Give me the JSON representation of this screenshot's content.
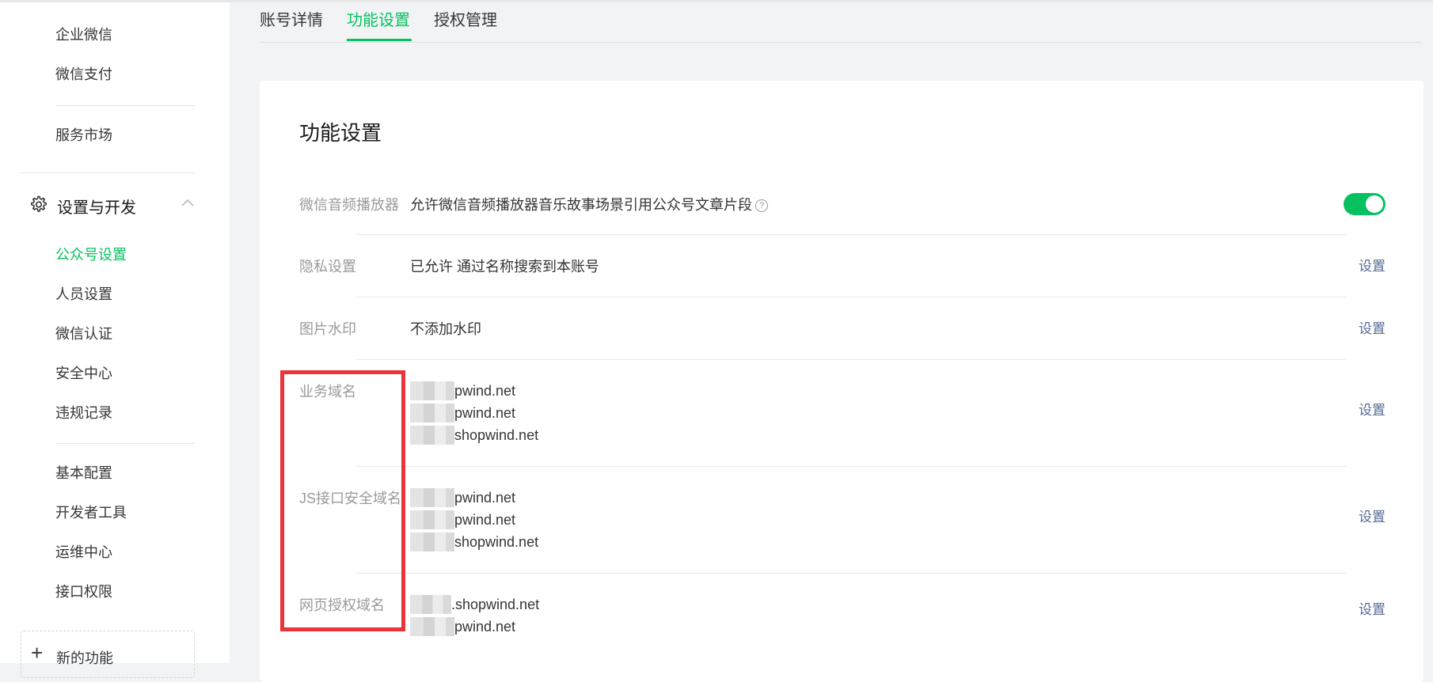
{
  "sidebar": {
    "items_top": [
      "企业微信",
      "微信支付"
    ],
    "market": "服务市场",
    "group_title": "设置与开发",
    "items_group1": [
      "公众号设置",
      "人员设置",
      "微信认证",
      "安全中心",
      "违规记录"
    ],
    "items_group2": [
      "基本配置",
      "开发者工具",
      "运维中心",
      "接口权限"
    ],
    "new_function": "新的功能"
  },
  "tabs": [
    "账号详情",
    "功能设置",
    "授权管理"
  ],
  "active_tab": "功能设置",
  "card": {
    "title": "功能设置",
    "rows": [
      {
        "label": "微信音频播放器",
        "value": "允许微信音频播放器音乐故事场景引用公众号文章片段",
        "help": "?",
        "toggle_on": true
      },
      {
        "label": "隐私设置",
        "value": "已允许 通过名称搜索到本账号",
        "action": "设置"
      },
      {
        "label": "图片水印",
        "value": "不添加水印",
        "action": "设置"
      },
      {
        "label": "业务域名",
        "domains": [
          "pwind.net",
          "pwind.net",
          "shopwind.net"
        ],
        "action": "设置"
      },
      {
        "label": "JS接口安全域名",
        "domains": [
          "pwind.net",
          "pwind.net",
          "shopwind.net"
        ],
        "action": "设置"
      },
      {
        "label": "网页授权域名",
        "domains": [
          ".shopwind.net",
          "pwind.net"
        ],
        "action": "设置"
      }
    ]
  },
  "colors": {
    "accent": "#07c160",
    "link": "#576b95",
    "highlight_box": "#e8343a"
  }
}
